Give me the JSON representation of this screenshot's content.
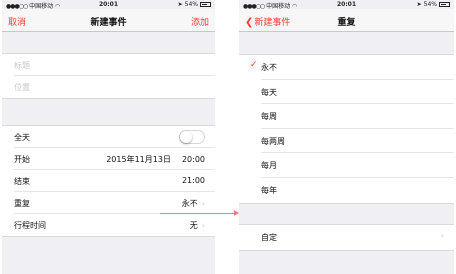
{
  "left": {
    "status": {
      "carrier": "中国移动",
      "time": "20:01",
      "battery": "54%"
    },
    "nav": {
      "cancel": "取消",
      "title": "新建事件",
      "add": "添加"
    },
    "fields": {
      "title_placeholder": "标题",
      "location_placeholder": "位置"
    },
    "rows": {
      "allday": "全天",
      "start_label": "开始",
      "start_date": "2015年11月13日",
      "start_time": "20:00",
      "end_label": "结束",
      "end_time": "21:00",
      "repeat_label": "重复",
      "repeat_value": "永不",
      "travel_label": "行程时间",
      "travel_value": "无"
    }
  },
  "right": {
    "status": {
      "carrier": "中国移动",
      "time": "20:01",
      "battery": "54%"
    },
    "nav": {
      "back": "新建事件",
      "title": "重复"
    },
    "options": [
      "永不",
      "每天",
      "每周",
      "每两周",
      "每月",
      "每年"
    ],
    "selected_index": 0,
    "custom": "自定"
  },
  "colors": {
    "accent": "#ff3b30",
    "background": "#efeff4"
  }
}
